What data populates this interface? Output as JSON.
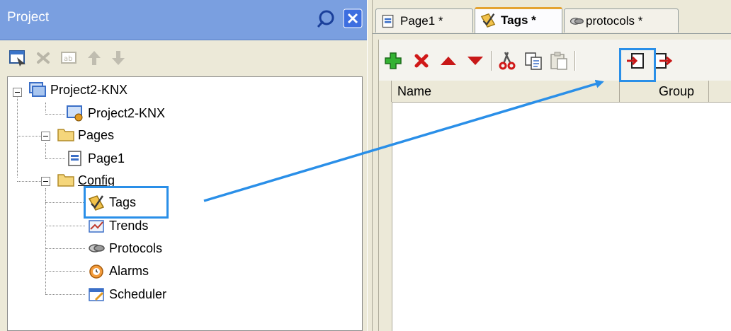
{
  "project_panel": {
    "title": "Project",
    "toolbar": {
      "items": [
        {
          "icon": "properties-icon",
          "enabled": true
        },
        {
          "icon": "delete-icon",
          "enabled": false
        },
        {
          "icon": "rename-icon",
          "enabled": false
        },
        {
          "icon": "move-up-icon",
          "enabled": false
        },
        {
          "icon": "move-down-icon",
          "enabled": false
        }
      ]
    },
    "tree": {
      "root": "Project2-KNX",
      "project_item": "Project2-KNX",
      "pages_folder": "Pages",
      "page1": "Page1",
      "config_folder": "Config",
      "tags": "Tags",
      "trends": "Trends",
      "protocols": "Protocols",
      "alarms": "Alarms",
      "scheduler": "Scheduler"
    }
  },
  "editor": {
    "tabs": [
      {
        "label": "Page1 *",
        "active": false
      },
      {
        "label": "Tags *",
        "active": true
      },
      {
        "label": "protocols *",
        "active": false
      }
    ],
    "toolbar": [
      "add-icon",
      "delete-icon",
      "move-up-icon",
      "move-down-icon",
      "cut-icon",
      "copy-icon",
      "paste-icon",
      "import-icon",
      "export-icon"
    ],
    "grid": {
      "columns": [
        "Name",
        "Group"
      ]
    }
  },
  "colors": {
    "highlight": "#2a8fe8",
    "panel_header": "#7a9fe0",
    "active_tab_accent": "#e4a332"
  }
}
